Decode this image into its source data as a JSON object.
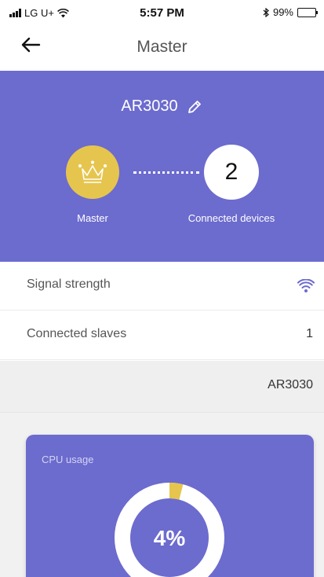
{
  "status_bar": {
    "carrier": "LG U+",
    "time": "5:57 PM",
    "battery": "99%",
    "battery_level": 0.99
  },
  "header": {
    "title": "Master",
    "back_icon": "arrow-left-icon"
  },
  "device": {
    "name": "AR3030",
    "master_label": "Master",
    "connected_count": "2",
    "connected_label": "Connected devices",
    "colors": {
      "panel": "#6c6bce",
      "master": "#e6c54e"
    }
  },
  "info": {
    "signal_label": "Signal strength",
    "signal_icon": "wifi-icon",
    "slaves_label": "Connected slaves",
    "slaves_value": "1",
    "slave_name": "AR3030"
  },
  "cpu": {
    "title": "CPU usage",
    "value_text": "4%",
    "value": 4,
    "colors": {
      "track": "#ffffff",
      "used": "#e6c54e"
    }
  }
}
